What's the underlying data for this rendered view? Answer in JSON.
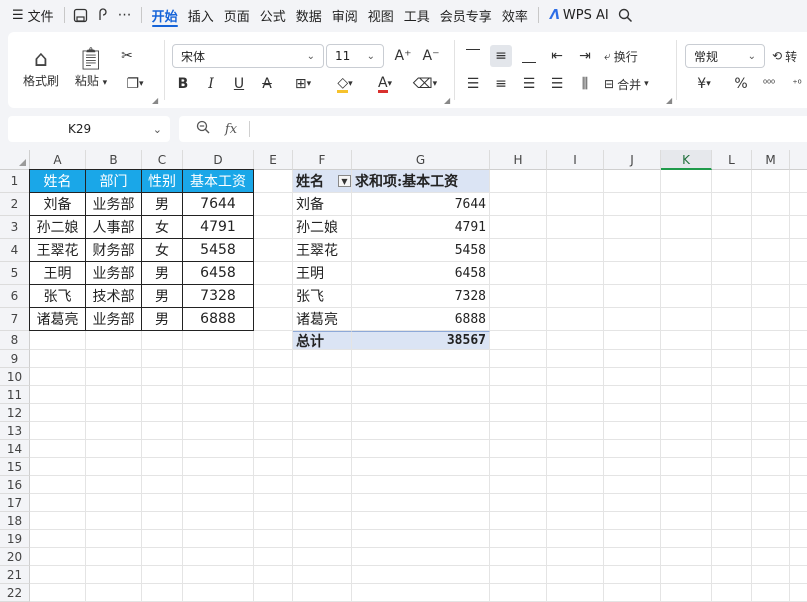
{
  "menu": {
    "file": "文件",
    "tabs": [
      {
        "label": "开始",
        "active": true
      },
      {
        "label": "插入"
      },
      {
        "label": "页面"
      },
      {
        "label": "公式"
      },
      {
        "label": "数据"
      },
      {
        "label": "审阅"
      },
      {
        "label": "视图"
      },
      {
        "label": "工具"
      },
      {
        "label": "会员专享"
      },
      {
        "label": "效率"
      }
    ],
    "wps_ai": "WPS AI"
  },
  "ribbon": {
    "format_painter": "格式刷",
    "paste": "粘贴",
    "font_name": "宋体",
    "font_size": "11",
    "wrap": "换行",
    "merge": "合并",
    "number_format": "常规",
    "convert": "转",
    "percent": "%",
    "currency": "¥"
  },
  "formula_bar": {
    "name_box": "K29",
    "fx": "fx",
    "value": ""
  },
  "grid": {
    "columns": [
      "A",
      "B",
      "C",
      "D",
      "E",
      "F",
      "G",
      "H",
      "I",
      "J",
      "K",
      "L",
      "M"
    ],
    "selected_column": "K",
    "rows": [
      "1",
      "2",
      "3",
      "4",
      "5",
      "6",
      "7",
      "8",
      "9",
      "10",
      "11",
      "12",
      "13",
      "14",
      "15",
      "16",
      "17",
      "18",
      "19",
      "20",
      "21",
      "22"
    ]
  },
  "source_table": {
    "headers": [
      "姓名",
      "部门",
      "性别",
      "基本工资"
    ],
    "rows": [
      [
        "刘备",
        "业务部",
        "男",
        "7644"
      ],
      [
        "孙二娘",
        "人事部",
        "女",
        "4791"
      ],
      [
        "王翠花",
        "财务部",
        "女",
        "5458"
      ],
      [
        "王明",
        "业务部",
        "男",
        "6458"
      ],
      [
        "张飞",
        "技术部",
        "男",
        "7328"
      ],
      [
        "诸葛亮",
        "业务部",
        "男",
        "6888"
      ]
    ]
  },
  "pivot": {
    "row_field": "姓名",
    "value_field": "求和项:基本工资",
    "rows": [
      [
        "刘备",
        "7644"
      ],
      [
        "孙二娘",
        "4791"
      ],
      [
        "王翠花",
        "5458"
      ],
      [
        "王明",
        "6458"
      ],
      [
        "张飞",
        "7328"
      ],
      [
        "诸葛亮",
        "6888"
      ]
    ],
    "total_label": "总计",
    "total_value": "38567"
  }
}
